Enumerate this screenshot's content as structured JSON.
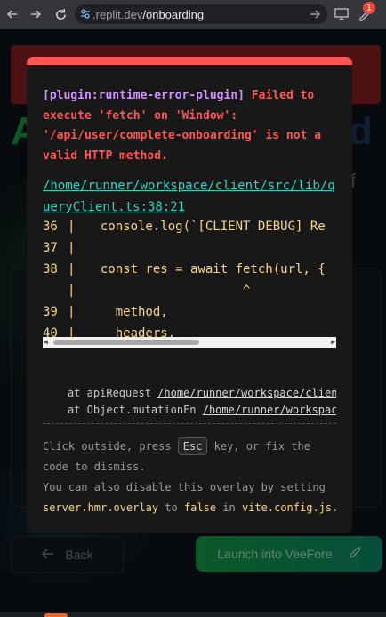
{
  "browser": {
    "url_host": ".replit.dev",
    "url_path": "/onboarding",
    "notification_count": "1"
  },
  "app": {
    "back_label": "Back",
    "launch_label": "Launch into VeeFore"
  },
  "error": {
    "plugin": "[plugin:runtime-error-plugin]",
    "message": " Failed to execute 'fetch' on 'Window': '/api/user/complete-onboarding' is not a valid HTTP method.",
    "file": "/home/runner/workspace/client/src/lib/queryClient.ts:38:21",
    "frame_lines": [
      {
        "num": "36",
        "code": "  console.log(`[CLIENT DEBUG] Re"
      },
      {
        "num": "37",
        "code": ""
      },
      {
        "num": "38",
        "code": "  const res = await fetch(url, {"
      },
      {
        "num": "",
        "code": "                     ^"
      },
      {
        "num": "39",
        "code": "    method,"
      },
      {
        "num": "40",
        "code": "    headers,"
      }
    ],
    "stack": [
      {
        "prefix": "at apiRequest ",
        "loc": "/home/runner/workspace/client/src/lib/queryClient.ts"
      },
      {
        "prefix": "at Object.mutationFn ",
        "loc": "/home/runner/workspace/client/src/pages/Onboarding.tsx"
      }
    ],
    "tip_1_a": "Click outside, press ",
    "tip_key": "Esc",
    "tip_1_b": " key, or fix the code to dismiss.",
    "tip_2_a": "You can also disable this overlay by setting ",
    "tip_2_code1": "server.hmr.overlay",
    "tip_2_b": " to ",
    "tip_2_code2": "false",
    "tip_2_c": " in ",
    "tip_2_code3": "vite.config.js",
    "tip_2_d": "."
  },
  "colors": {
    "error_red": "#ff5555",
    "plugin_purple": "#cf94ff",
    "link_teal": "#2dd4bf",
    "code_yellow": "#f5d58a",
    "brand_green": "#16a34a"
  }
}
